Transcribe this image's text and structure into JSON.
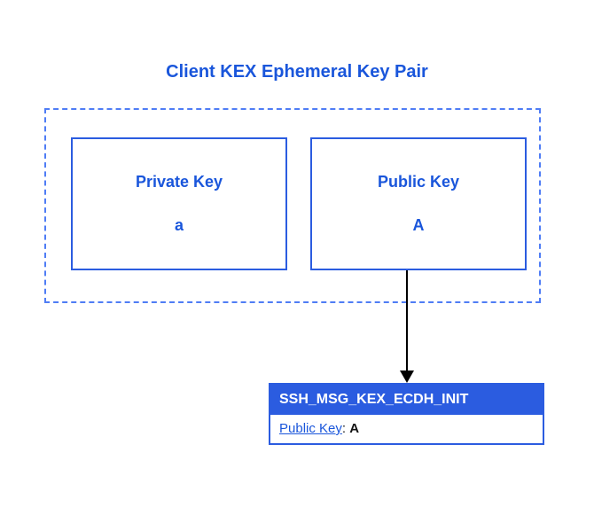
{
  "title": "Client KEX Ephemeral Key Pair",
  "keys": {
    "private": {
      "label": "Private Key",
      "value": "a"
    },
    "public": {
      "label": "Public Key",
      "value": "A"
    }
  },
  "message": {
    "header": "SSH_MSG_KEX_ECDH_INIT",
    "fieldLabel": "Public Key",
    "fieldValue": "A"
  }
}
